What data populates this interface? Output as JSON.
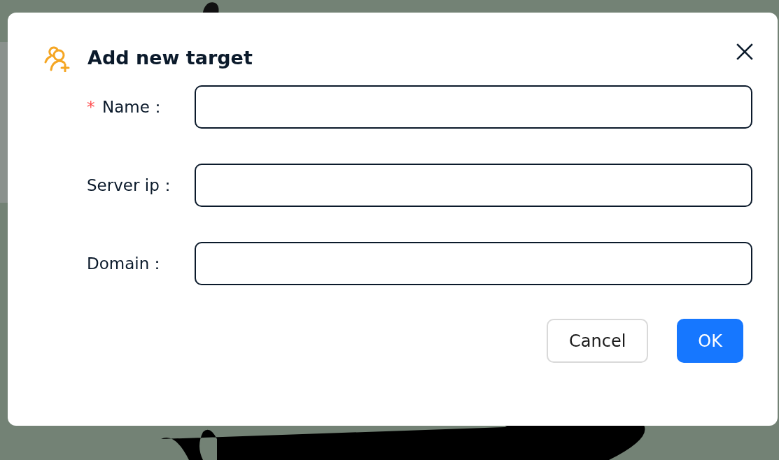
{
  "dialog": {
    "title": "Add new target",
    "fields": [
      {
        "label": "Name：",
        "required_marker": "*"
      },
      {
        "label": "Server ip："
      },
      {
        "label": "Domain："
      }
    ],
    "buttons": [
      {
        "label": "Cancel",
        "kind": "secondary"
      },
      {
        "label": "OK",
        "kind": "primary"
      }
    ]
  }
}
